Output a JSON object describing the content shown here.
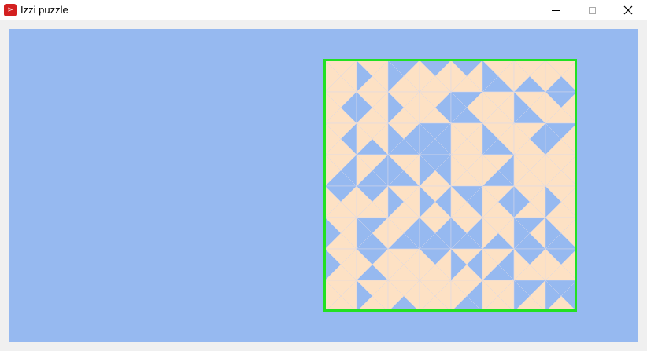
{
  "window": {
    "title": "Izzi puzzle",
    "app_icon": "izzi-app-icon"
  },
  "controls": {
    "minimize_icon": "minimize-icon",
    "maximize_icon": "maximize-icon",
    "close_icon": "close-icon"
  },
  "colors": {
    "background": "#96b9f0",
    "tile_light": "#fde1c4",
    "tile_blue": "#96b9f0",
    "board_border": "#22e022",
    "grid_lines": "#d8d8e8"
  },
  "board": {
    "rows": 8,
    "cols": 8
  }
}
